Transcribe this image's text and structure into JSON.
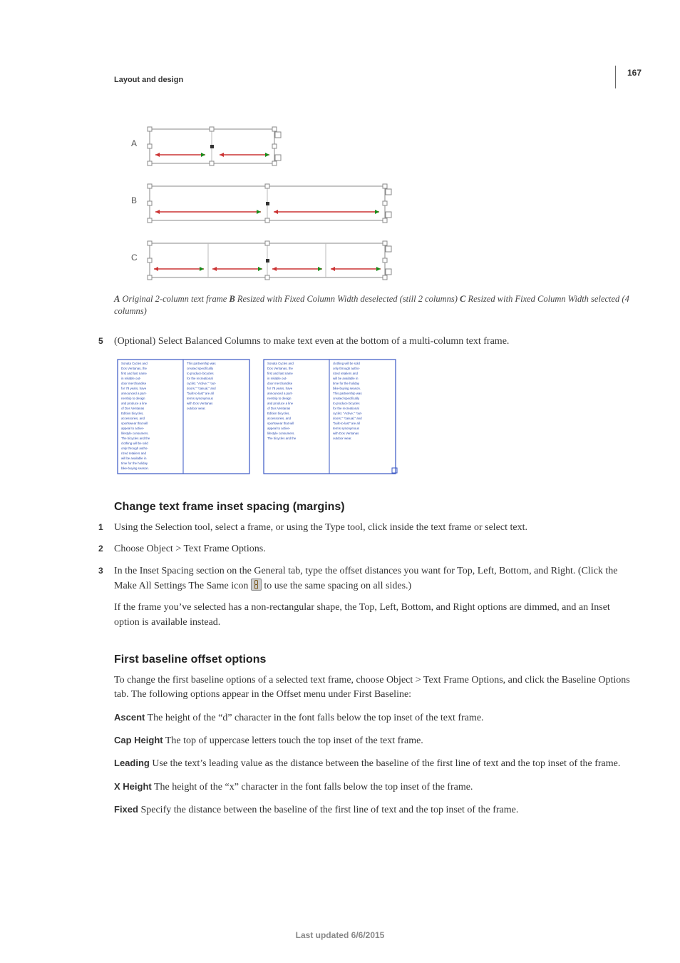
{
  "page_number": "167",
  "running_head": "Layout and design",
  "figure1": {
    "rowA": "A",
    "rowB": "B",
    "rowC": "C",
    "caption_A_label": "A",
    "caption_A_text": " Original 2-column text frame  ",
    "caption_B_label": "B",
    "caption_B_text": " Resized with Fixed Column Width deselected (still 2 columns)  ",
    "caption_C_label": "C",
    "caption_C_text": " Resized with Fixed Column Width selected (4 columns)"
  },
  "step5": {
    "num": "5",
    "text": "(Optional) Select Balanced Columns to make text even at the bottom of a multi-column text frame."
  },
  "section_inset": {
    "title": "Change text frame inset spacing (margins)",
    "step1_num": "1",
    "step1_text": "Using the Selection tool, select a frame, or using the Type tool, click inside the text frame or select text.",
    "step2_num": "2",
    "step2_text": "Choose Object > Text Frame Options.",
    "step3_num": "3",
    "step3_text_a": "In the Inset Spacing section on the General tab, type the offset distances you want for Top, Left, Bottom, and Right. (Click the Make All Settings The Same icon ",
    "step3_text_b": " to use the same spacing on all sides.)",
    "after_para": "If the frame you’ve selected has a non-rectangular shape, the Top, Left, Bottom, and Right options are dimmed, and an Inset option is available instead."
  },
  "section_baseline": {
    "title": "First baseline offset options",
    "intro": "To change the first baseline options of a selected text frame, choose Object > Text Frame Options, and click the Baseline Options tab. The following options appear in the Offset menu under First Baseline:",
    "ascent_term": "Ascent",
    "ascent_def": "  The height of the “d” character in the font falls below the top inset of the text frame.",
    "cap_term": "Cap Height",
    "cap_def": "  The top of uppercase letters touch the top inset of the text frame.",
    "leading_term": "Leading",
    "leading_def": "  Use the text’s leading value as the distance between the baseline of the first line of text and the top inset of the frame.",
    "xheight_term": "X Height",
    "xheight_def": "  The height of the “x” character in the font falls below the top inset of the frame.",
    "fixed_term": "Fixed",
    "fixed_def": "  Specify the distance between the baseline of the first line of text and the top inset of the frame."
  },
  "footer": "Last updated 6/6/2015"
}
